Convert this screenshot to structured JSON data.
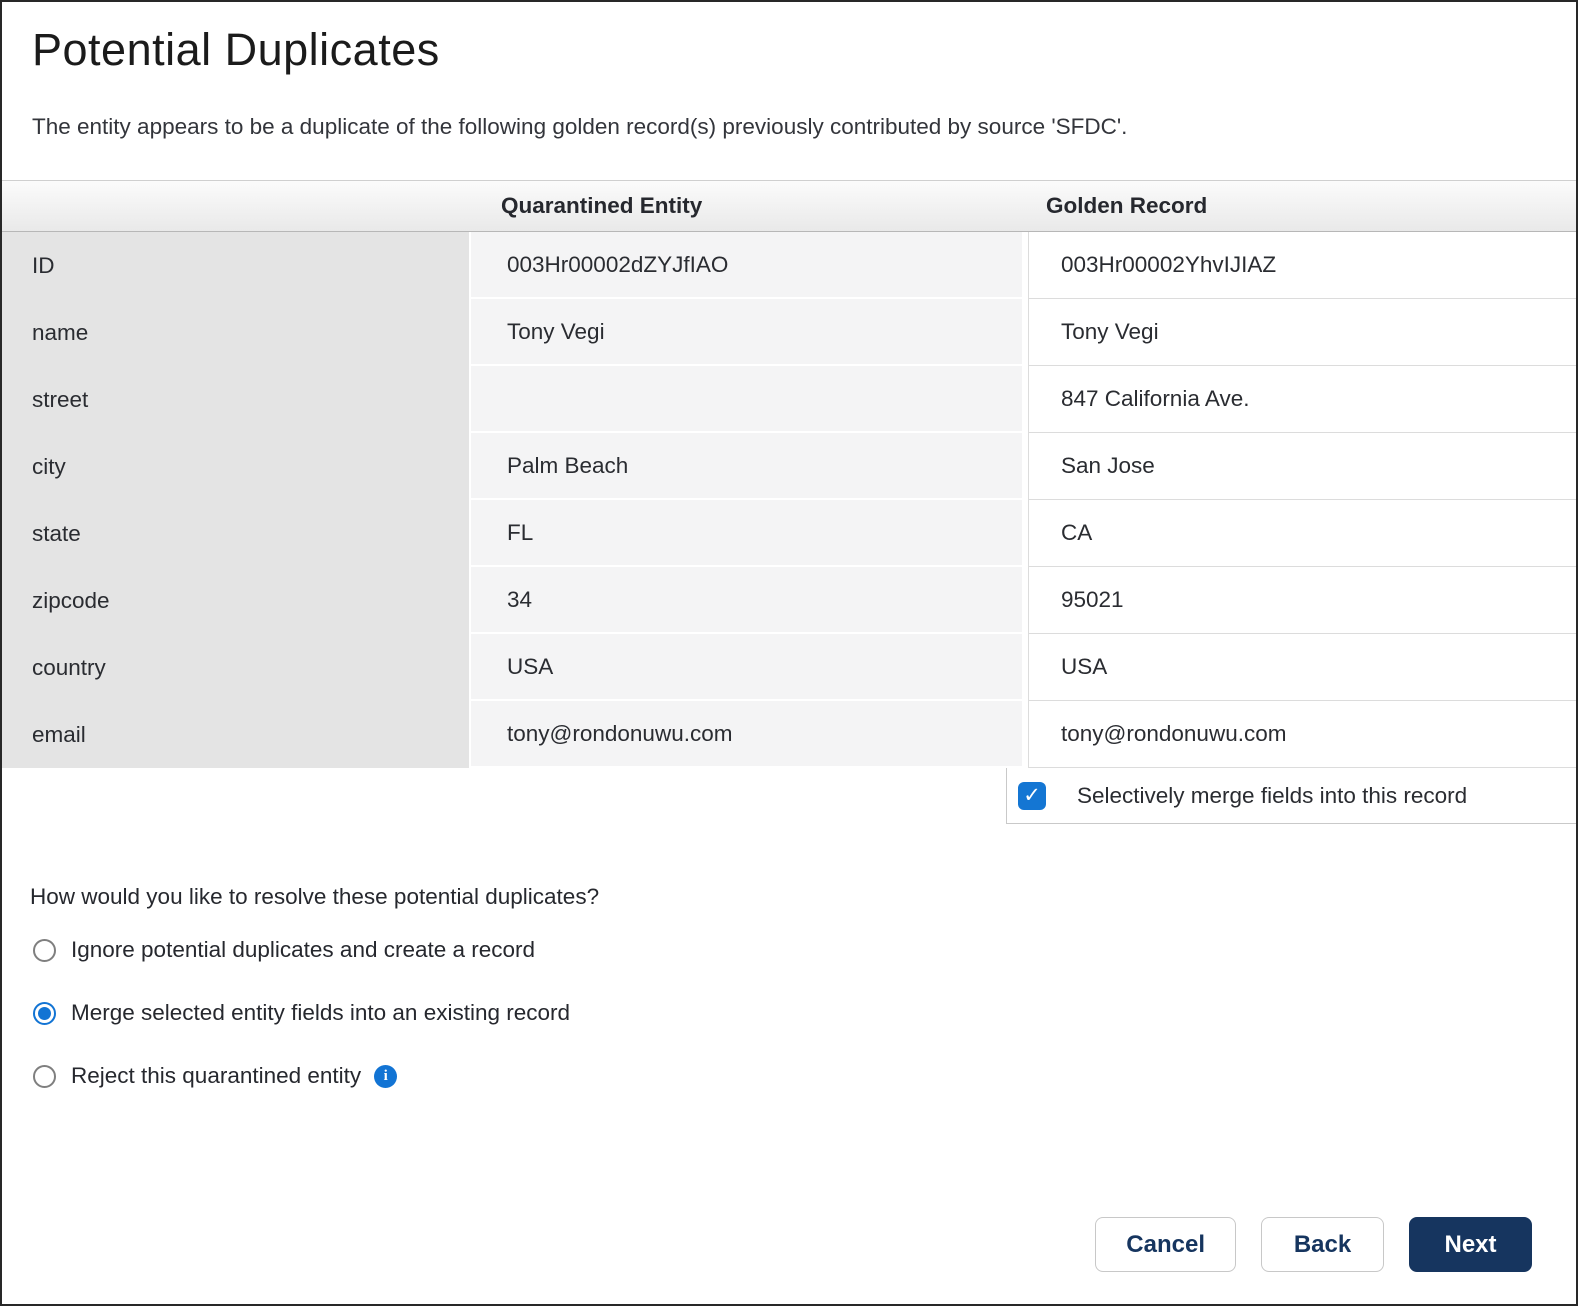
{
  "page": {
    "title": "Potential Duplicates",
    "intro": "The entity appears to be a duplicate of the following golden record(s) previously contributed by source 'SFDC'."
  },
  "table": {
    "columns": [
      "Quarantined Entity",
      "Golden Record"
    ],
    "rows": [
      {
        "label": "ID",
        "quarantined": "003Hr00002dZYJfIAO",
        "golden": "003Hr00002YhvIJIAZ"
      },
      {
        "label": "name",
        "quarantined": "Tony Vegi",
        "golden": "Tony Vegi"
      },
      {
        "label": "street",
        "quarantined": "",
        "golden": "847 California Ave."
      },
      {
        "label": "city",
        "quarantined": "Palm Beach",
        "golden": "San Jose"
      },
      {
        "label": "state",
        "quarantined": "FL",
        "golden": "CA"
      },
      {
        "label": "zipcode",
        "quarantined": "34",
        "golden": "95021"
      },
      {
        "label": "country",
        "quarantined": "USA",
        "golden": "USA"
      },
      {
        "label": "email",
        "quarantined": "tony@rondonuwu.com",
        "golden": "tony@rondonuwu.com"
      }
    ]
  },
  "merge_checkbox": {
    "label": "Selectively merge fields into this record",
    "checked": true,
    "check_icon": "✓"
  },
  "resolution": {
    "question": "How would you like to resolve these potential duplicates?",
    "options": [
      {
        "label": "Ignore potential duplicates and create a record",
        "selected": false
      },
      {
        "label": "Merge selected entity fields into an existing record",
        "selected": true
      },
      {
        "label": "Reject this quarantined entity",
        "selected": false,
        "has_info": true
      }
    ],
    "info_icon": "i"
  },
  "buttons": {
    "cancel": "Cancel",
    "back": "Back",
    "next": "Next"
  },
  "colors": {
    "accent_blue": "#1274d4",
    "navy": "#16355f",
    "label_column_bg": "#e4e4e4",
    "quarantined_column_bg": "#f4f4f5"
  }
}
